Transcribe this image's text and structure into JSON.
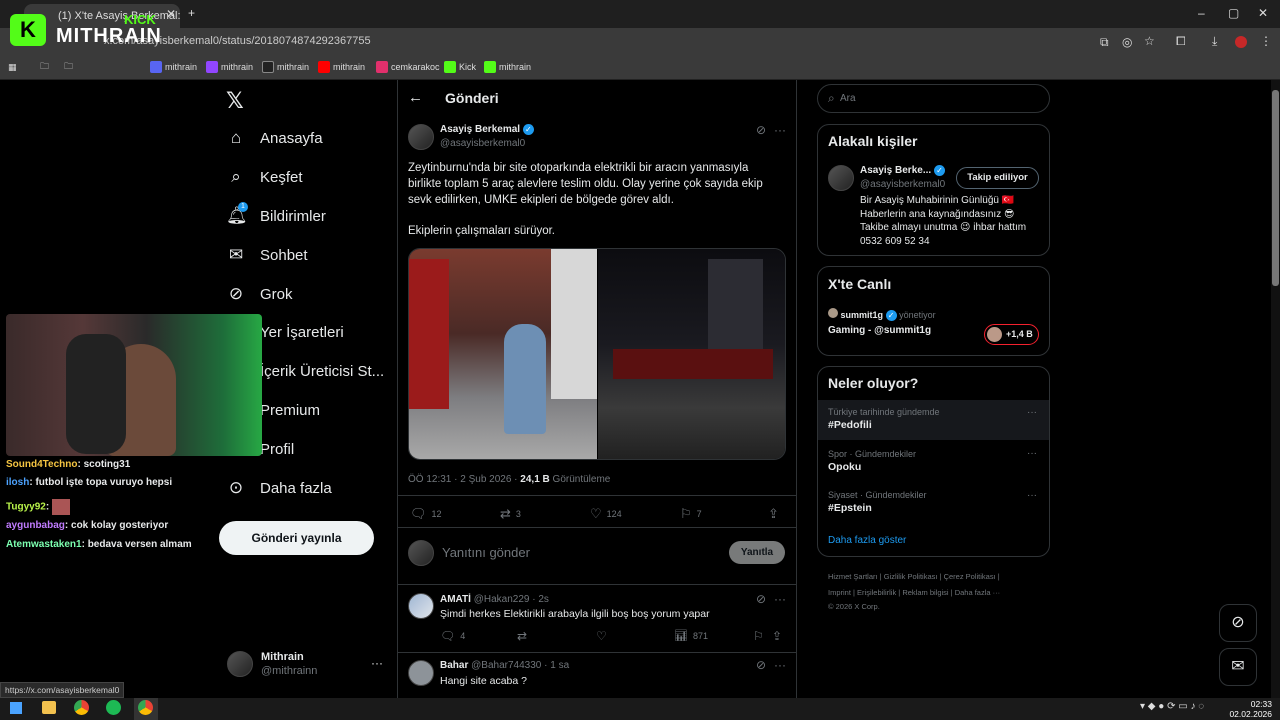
{
  "browser": {
    "tab_title": "(1) X'te Asayiş Berkemal: \"Zey",
    "url": "x.com/asayisberkemal0/status/2018074874292367755",
    "bookmarks": [
      "mithrain",
      "mithrain",
      "mithrain",
      "mithrain",
      "cemkarakoc",
      "Kick",
      "mithrain"
    ],
    "status_url": "https://x.com/asayisberkemal0"
  },
  "overlay": {
    "brand_top": "KICK",
    "brand_name": "MITHRAIN"
  },
  "nav": {
    "items": [
      {
        "label": "Anasayfa",
        "icon": "home-icon"
      },
      {
        "label": "Keşfet",
        "icon": "search-icon"
      },
      {
        "label": "Bildirimler",
        "icon": "bell-icon",
        "badge": "1"
      },
      {
        "label": "Sohbet",
        "icon": "mail-icon"
      },
      {
        "label": "Grok",
        "icon": "grok-icon"
      },
      {
        "label": "Yer İşaretleri",
        "icon": "bookmark-icon"
      },
      {
        "label": "İçerik Üreticisi St...",
        "icon": "creator-icon"
      },
      {
        "label": "Premium",
        "icon": "x-icon"
      },
      {
        "label": "Profil",
        "icon": "person-icon"
      },
      {
        "label": "Daha fazla",
        "icon": "more-icon"
      }
    ],
    "post_button": "Gönderi yayınla",
    "account": {
      "name": "Mithrain",
      "handle": "@mithrainn"
    }
  },
  "chat": [
    {
      "user": "Sound4Techno",
      "text": ": scoting31",
      "color": "#f5c542"
    },
    {
      "user": "ilosh",
      "text": ": futbol işte topa vuruyo hepsi",
      "color": "#4da3ff"
    },
    {
      "user": "Tugyy92",
      "text": ":",
      "color": "#b8f24a"
    },
    {
      "user": "aygunbabag",
      "text": ": cok kolay gosteriyor",
      "color": "#c07cff"
    },
    {
      "user": "Atemwastaken1",
      "text": ": bedava versen almam",
      "color": "#7cffb0"
    }
  ],
  "post": {
    "header": "Gönderi",
    "author": "Asayiş Berkemal",
    "handle": "@asayisberkemal0",
    "text1": "Zeytinburnu'nda bir site otoparkında elektrikli bir aracın yanmasıyla birlikte toplam 5 araç alevlere teslim oldu. Olay yerine çok sayıda ekip sevk edilirken, UMKE ekipleri de bölgede görev aldı.",
    "text2": "Ekiplerin çalışmaları sürüyor.",
    "time": "ÖÖ 12:31 · 2 Şub 2026 ·",
    "views": "24,1 B",
    "views_label": "Görüntüleme",
    "replies": "12",
    "reposts": "3",
    "likes": "124",
    "bookmarks": "7",
    "reply_placeholder": "Yanıtını gönder",
    "reply_button": "Yanıtla"
  },
  "replies": [
    {
      "name": "AMATİ",
      "handle": "@Hakan229 · 2s",
      "text": "Şimdi herkes Elektirikli arabayla ilgili boş boş yorum yapar",
      "replies": "4",
      "views": "871"
    },
    {
      "name": "Bahar",
      "handle": "@Bahar744330 · 1 sa",
      "text": "Hangi site acaba ?"
    }
  ],
  "right": {
    "search_placeholder": "Ara",
    "related_title": "Alakalı kişiler",
    "related": {
      "name": "Asayiş Berke...",
      "handle": "@asayisberkemal0",
      "follow": "Takip ediliyor",
      "bio": "Bir Asayiş Muhabirinin Günlüğü 🇹🇷 Haberlerin ana kaynağındasınız 😎 Takibe almayı unutma 😉 ihbar hattım 0532 609 52 34"
    },
    "live_title": "X'te Canlı",
    "live": {
      "host": "summit1g",
      "status": "yönetiyor",
      "title": "Gaming - @summit1g",
      "count": "+1,4 B"
    },
    "trends_title": "Neler oluyor?",
    "trends": [
      {
        "context": "Türkiye tarihinde gündemde",
        "name": "#Pedofili"
      },
      {
        "context": "Spor · Gündemdekiler",
        "name": "Opoku"
      },
      {
        "context": "Siyaset · Gündemdekiler",
        "name": "#Epstein"
      }
    ],
    "show_more": "Daha fazla göster",
    "footer1": "Hizmet Şartları  |  Gizlilik Politikası  |  Çerez Politikası  |",
    "footer2": "Imprint  |  Erişilebilirlik  |  Reklam bilgisi  |  Daha fazla ···",
    "footer3": "© 2026 X Corp."
  },
  "taskbar": {
    "time": "02:33",
    "date": "02.02.2026"
  }
}
